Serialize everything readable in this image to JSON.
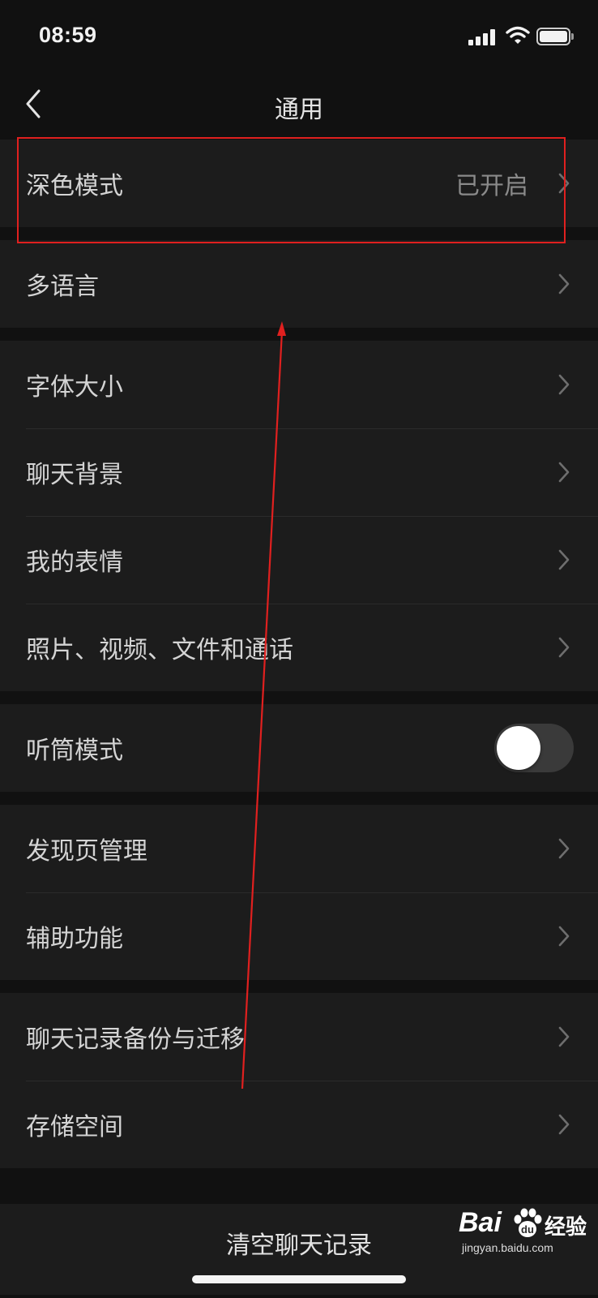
{
  "status_bar": {
    "time": "08:59"
  },
  "nav": {
    "title": "通用"
  },
  "groups": [
    {
      "rows": [
        {
          "label": "深色模式",
          "value": "已开启"
        }
      ]
    },
    {
      "rows": [
        {
          "label": "多语言"
        }
      ]
    },
    {
      "rows": [
        {
          "label": "字体大小"
        },
        {
          "label": "聊天背景"
        },
        {
          "label": "我的表情"
        },
        {
          "label": "照片、视频、文件和通话"
        }
      ]
    },
    {
      "rows": [
        {
          "label": "听筒模式",
          "toggle": false
        }
      ]
    },
    {
      "rows": [
        {
          "label": "发现页管理"
        },
        {
          "label": "辅助功能"
        }
      ]
    },
    {
      "rows": [
        {
          "label": "聊天记录备份与迁移"
        },
        {
          "label": "存储空间"
        }
      ]
    }
  ],
  "clear_button": {
    "label": "清空聊天记录"
  },
  "watermark": {
    "brand": "Bai",
    "suffix": "经验",
    "url": "jingyan.baidu.com"
  },
  "colors": {
    "background": "#111111",
    "cell": "#1c1c1c",
    "annotation": "#e0201f",
    "toggle_off": "#3a3a3a"
  },
  "icons": [
    "back-icon",
    "chevron-right-icon",
    "signal-icon",
    "wifi-icon",
    "battery-icon",
    "baidu-paw-icon"
  ]
}
